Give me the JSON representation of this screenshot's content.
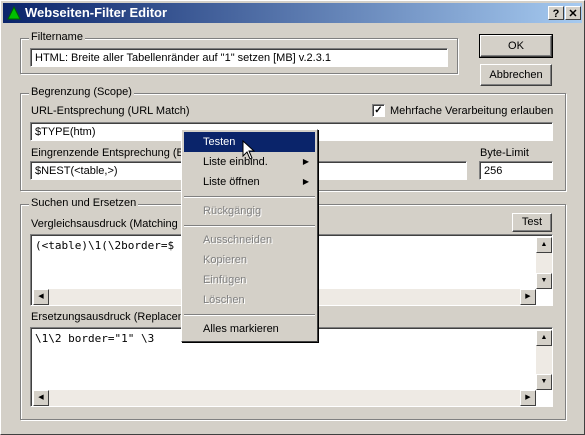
{
  "window": {
    "title": "Webseiten-Filter Editor",
    "help_label": "?",
    "close_label": "✕"
  },
  "filtername": {
    "legend": "Filtername",
    "value": "HTML: Breite aller Tabellenränder auf \"1\" setzen [MB] v.2.3.1"
  },
  "buttons": {
    "ok": "OK",
    "cancel": "Abbrechen",
    "test": "Test"
  },
  "scope": {
    "legend": "Begrenzung (Scope)",
    "url_label": "URL-Entsprechung (URL Match)",
    "url_value": "$TYPE(htm)",
    "multi_label": "Mehrfache Verarbeitung erlauben",
    "multi_checked": "✓",
    "bounds_label": "Eingrenzende Entsprechung (Bo",
    "bounds_value": "$NEST(<table,>)",
    "bytelimit_label": "Byte-Limit",
    "bytelimit_value": "256"
  },
  "search": {
    "legend": "Suchen und Ersetzen",
    "match_label": "Vergleichsausdruck (Matching E",
    "match_value": "(<table)\\1(\\2border=$",
    "replace_label": "Ersetzungsausdruck (Replacem",
    "replace_value": "\\1\\2 border=\"1\" \\3"
  },
  "context_menu": {
    "items": [
      {
        "label": "Testen",
        "state": "selected"
      },
      {
        "label": "Liste einbind.",
        "submenu": true
      },
      {
        "label": "Liste öffnen",
        "submenu": true
      },
      {
        "label": "Rückgängig",
        "state": "disabled"
      },
      {
        "label": "Ausschneiden",
        "state": "disabled"
      },
      {
        "label": "Kopieren",
        "state": "disabled"
      },
      {
        "label": "Einfügen",
        "state": "disabled"
      },
      {
        "label": "Löschen",
        "state": "disabled"
      },
      {
        "label": "Alles markieren"
      }
    ]
  }
}
